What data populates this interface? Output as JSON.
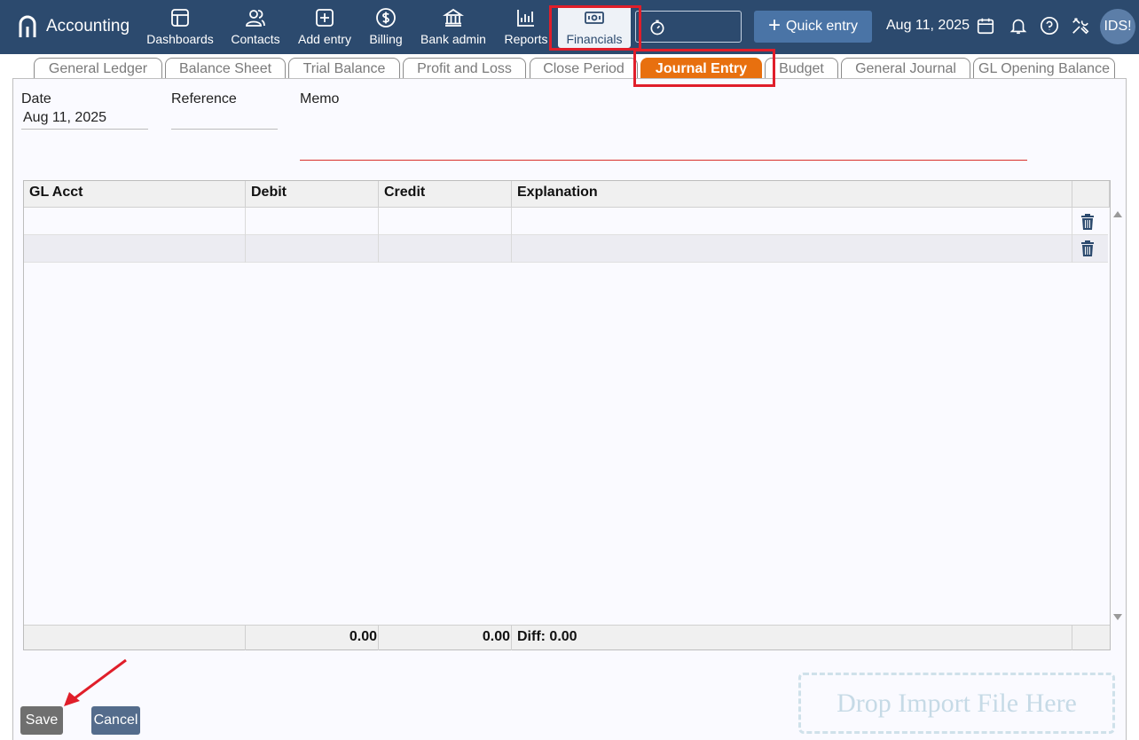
{
  "app": {
    "name": "Accounting",
    "colors": {
      "topbar": "#2c4a6e",
      "accent": "#e8700f",
      "quick_entry": "#4a74a6",
      "highlight": "#e01e2a"
    }
  },
  "nav": {
    "items": [
      {
        "label": "Dashboards",
        "icon": "dashboard-icon"
      },
      {
        "label": "Contacts",
        "icon": "contacts-icon"
      },
      {
        "label": "Add entry",
        "icon": "add-entry-icon"
      },
      {
        "label": "Billing",
        "icon": "dollar-icon"
      },
      {
        "label": "Bank admin",
        "icon": "bank-icon"
      },
      {
        "label": "Reports",
        "icon": "bar-chart-icon"
      },
      {
        "label": "Financials",
        "icon": "money-icon",
        "active": true
      }
    ],
    "timer_icon": "stopwatch-icon",
    "quick_entry_label": "Quick entry",
    "date": "Aug 11, 2025",
    "avatar": "IDS!"
  },
  "tabs": [
    {
      "label": "General Ledger"
    },
    {
      "label": "Balance Sheet"
    },
    {
      "label": "Trial Balance"
    },
    {
      "label": "Profit and Loss"
    },
    {
      "label": "Close Period"
    },
    {
      "label": "Journal Entry",
      "active": true
    },
    {
      "label": "Budget"
    },
    {
      "label": "General Journal"
    },
    {
      "label": "GL Opening Balance"
    }
  ],
  "form": {
    "date_label": "Date",
    "date_value": "Aug 11, 2025",
    "reference_label": "Reference",
    "reference_value": "",
    "memo_label": "Memo",
    "memo_value": ""
  },
  "grid": {
    "columns": [
      "GL Acct",
      "Debit",
      "Credit",
      "Explanation"
    ],
    "rows": [
      {
        "gl_acct": "",
        "debit": "",
        "credit": "",
        "explanation": ""
      },
      {
        "gl_acct": "",
        "debit": "",
        "credit": "",
        "explanation": ""
      }
    ],
    "totals": {
      "debit": "0.00",
      "credit": "0.00",
      "diff": "Diff: 0.00"
    }
  },
  "actions": {
    "save_label": "Save",
    "cancel_label": "Cancel",
    "drop_label": "Drop Import File Here"
  }
}
